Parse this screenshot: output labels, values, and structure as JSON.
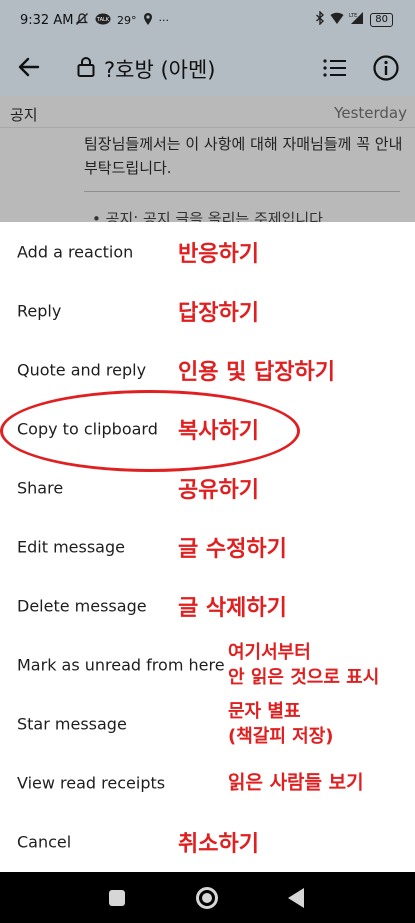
{
  "status_bar": {
    "time": "9:32 AM",
    "temperature": "29°",
    "more": "···",
    "battery": "80"
  },
  "app_bar": {
    "title": "?호방 (아멘)"
  },
  "chat": {
    "channel_label": "공지",
    "date": "Yesterday",
    "message_text": "팀장님들께서는 이 사항에 대해 자매님들께 꼭 안내 부탁드립니다.",
    "bullet_text": "• 공지: 공지 글을 올리는 주제입니다"
  },
  "menu": {
    "items": [
      {
        "label": "Add a reaction",
        "annotation": "반응하기"
      },
      {
        "label": "Reply",
        "annotation": "답장하기"
      },
      {
        "label": "Quote and reply",
        "annotation": "인용 및 답장하기"
      },
      {
        "label": "Copy to clipboard",
        "annotation": "복사하기"
      },
      {
        "label": "Share",
        "annotation": "공유하기"
      },
      {
        "label": "Edit message",
        "annotation": "글 수정하기"
      },
      {
        "label": "Delete message",
        "annotation": "글 삭제하기"
      },
      {
        "label": "Mark as unread from here",
        "annotation_line1": "여기서부터",
        "annotation_line2": "안 읽은 것으로 표시"
      },
      {
        "label": "Star message",
        "annotation_line1": "문자 별표",
        "annotation_line2": "(책갈피 저장)"
      },
      {
        "label": "View read receipts",
        "annotation": "읽은 사람들 보기"
      },
      {
        "label": "Cancel",
        "annotation": "취소하기"
      }
    ]
  },
  "colors": {
    "header_bg": "#b3bcc3",
    "annotation_red": "#e02020",
    "nav_bg": "#000000"
  }
}
